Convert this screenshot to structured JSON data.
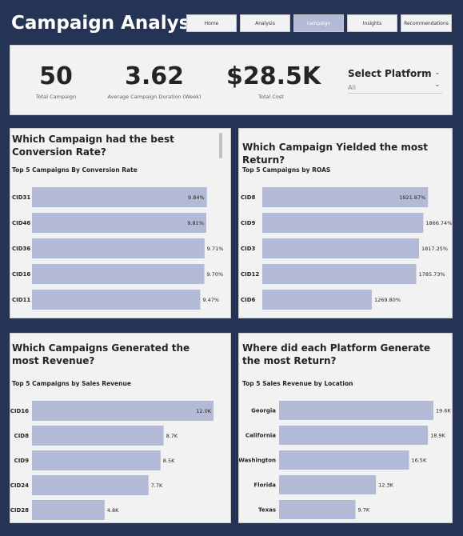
{
  "app": {
    "title": "Campaign Analysis"
  },
  "nav": {
    "items": [
      "Home",
      "Analysis",
      "campaign",
      "Insights",
      "Recommendations"
    ],
    "active": "campaign"
  },
  "kpis": [
    {
      "value": "50",
      "label": "Total Campaign"
    },
    {
      "value": "3.62",
      "label": "Average Campaign Duration (Week)"
    },
    {
      "value": "$28.5K",
      "label": "Total Cost"
    }
  ],
  "slicer": {
    "title": "Select Platform",
    "value": "All"
  },
  "colors": {
    "bar": "#b3bad6",
    "background": "#253454",
    "panel": "#f2f2f2"
  },
  "panels": {
    "conversion": {
      "title": "Which Campaign had the best Conversion Rate?",
      "subtitle": "Top 5 Campaigns By Conversion Rate"
    },
    "roas": {
      "title": "Which Campaign Yielded the most Return?",
      "subtitle": "Top 5 Campaigns by ROAS"
    },
    "revenue": {
      "title": "Which Campaigns Generated the most Revenue?",
      "subtitle": "Top 5 Campaigns by Sales Revenue"
    },
    "location": {
      "title": "Where did each Platform Generate the most Return?",
      "subtitle": "Top 5 Sales Revenue by Location"
    }
  },
  "chart_data": [
    {
      "id": "conversion",
      "type": "bar",
      "orientation": "horizontal",
      "categories": [
        "CID31",
        "CID46",
        "CID36",
        "CID16",
        "CID11"
      ],
      "values": [
        9.84,
        9.81,
        9.71,
        9.7,
        9.47
      ],
      "labels": [
        "9.84%",
        "9.81%",
        "9.71%",
        "9.70%",
        "9.47%"
      ],
      "title": "Top 5 Campaigns By Conversion Rate",
      "xlim": [
        0,
        9.9
      ]
    },
    {
      "id": "roas",
      "type": "bar",
      "orientation": "horizontal",
      "categories": [
        "CID8",
        "CID9",
        "CID3",
        "CID12",
        "CID6"
      ],
      "values": [
        1921.87,
        1866.74,
        1817.25,
        1785.73,
        1269.8
      ],
      "labels": [
        "1921.87%",
        "1866.74%",
        "1817.25%",
        "1785.73%",
        "1269.80%"
      ],
      "title": "Top 5 Campaigns by ROAS",
      "xlim": [
        0,
        2040
      ]
    },
    {
      "id": "revenue",
      "type": "bar",
      "orientation": "horizontal",
      "categories": [
        "CID16",
        "CID8",
        "CID9",
        "CID24",
        "CID28"
      ],
      "values": [
        12.0,
        8.7,
        8.5,
        7.7,
        4.8
      ],
      "labels": [
        "12.0K",
        "8.7K",
        "8.5K",
        "7.7K",
        "4.8K"
      ],
      "title": "Top 5 Campaigns by Sales Revenue",
      "xlim": [
        0,
        12.0
      ]
    },
    {
      "id": "location",
      "type": "bar",
      "orientation": "horizontal",
      "categories": [
        "Georgia",
        "California",
        "Washington",
        "Florida",
        "Texas"
      ],
      "values": [
        19.6,
        18.9,
        16.5,
        12.3,
        9.7
      ],
      "labels": [
        "19.6K",
        "18.9K",
        "16.5K",
        "12.3K",
        "9.7K"
      ],
      "title": "Top 5 Sales Revenue by Location",
      "xlim": [
        0,
        19.6
      ]
    }
  ]
}
